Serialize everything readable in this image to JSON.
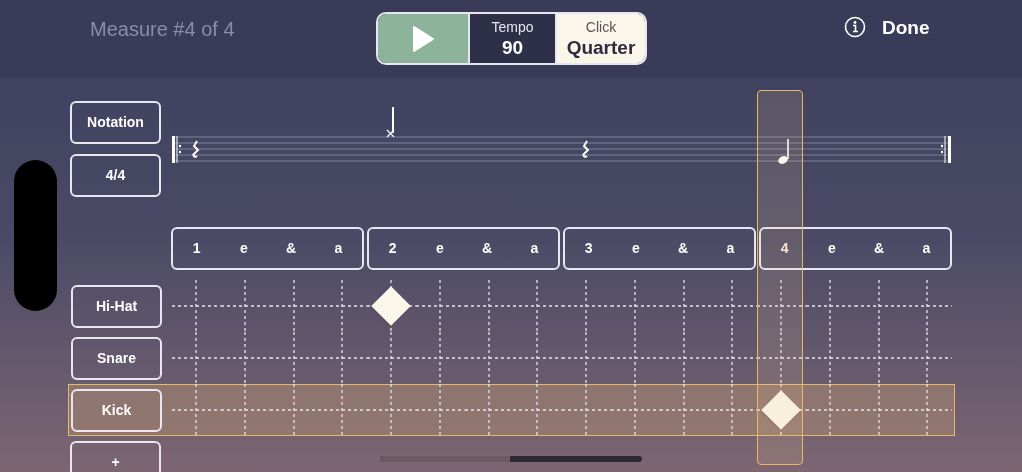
{
  "header": {
    "measure": "Measure #4 of 4",
    "tempo": {
      "label": "Tempo",
      "value": "90"
    },
    "click": {
      "label": "Click",
      "value": "Quarter"
    },
    "done": "Done"
  },
  "buttons": [
    {
      "label": "Notation"
    },
    {
      "label": "4/4"
    }
  ],
  "beats": [
    {
      "steps": [
        {
          "label": "1",
          "current": false
        },
        {
          "label": "e",
          "current": false
        },
        {
          "label": "&",
          "current": false
        },
        {
          "label": "a",
          "current": false
        }
      ]
    },
    {
      "steps": [
        {
          "label": "2",
          "current": false
        },
        {
          "label": "e",
          "current": false
        },
        {
          "label": "&",
          "current": false
        },
        {
          "label": "a",
          "current": false
        }
      ]
    },
    {
      "steps": [
        {
          "label": "3",
          "current": false
        },
        {
          "label": "e",
          "current": false
        },
        {
          "label": "&",
          "current": false
        },
        {
          "label": "a",
          "current": false
        }
      ]
    },
    {
      "steps": [
        {
          "label": "4",
          "current": true
        },
        {
          "label": "e",
          "current": false
        },
        {
          "label": "&",
          "current": false
        },
        {
          "label": "a",
          "current": false
        }
      ]
    }
  ],
  "instruments": [
    {
      "label": "Hi-Hat",
      "selected": false,
      "steps": [
        false,
        false,
        false,
        false,
        true,
        false,
        false,
        false,
        false,
        false,
        false,
        false,
        false,
        false,
        false,
        false
      ]
    },
    {
      "label": "Snare",
      "selected": false,
      "steps": [
        false,
        false,
        false,
        false,
        false,
        false,
        false,
        false,
        false,
        false,
        false,
        false,
        false,
        false,
        false,
        false
      ]
    },
    {
      "label": "Kick",
      "selected": true,
      "steps": [
        false,
        false,
        false,
        false,
        false,
        false,
        false,
        false,
        false,
        false,
        false,
        false,
        true,
        false,
        false,
        false
      ]
    }
  ],
  "add_button": "+"
}
